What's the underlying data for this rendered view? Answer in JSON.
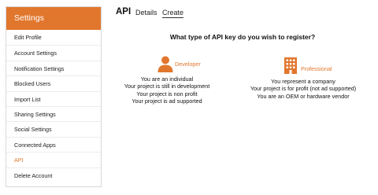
{
  "sidebar": {
    "header": "Settings",
    "items": [
      {
        "label": "Edit Profile"
      },
      {
        "label": "Account Settings"
      },
      {
        "label": "Notification Settings"
      },
      {
        "label": "Blocked Users"
      },
      {
        "label": "Import List"
      },
      {
        "label": "Sharing Settings"
      },
      {
        "label": "Social Settings"
      },
      {
        "label": "Connected Apps"
      },
      {
        "label": "API"
      },
      {
        "label": "Delete Account"
      }
    ],
    "active_item": "API"
  },
  "header": {
    "title": "API",
    "tabs": [
      {
        "label": "Details"
      },
      {
        "label": "Create"
      }
    ],
    "active_tab": "Create"
  },
  "main": {
    "question": "What type of API key do you wish to register?",
    "options": {
      "developer": {
        "icon": "person-icon",
        "title": "Developer",
        "lines": [
          "You are an individual",
          "Your project is still in development",
          "Your project is non profit",
          "Your project is ad supported"
        ]
      },
      "professional": {
        "icon": "building-icon",
        "title": "Professional",
        "lines": [
          "You represent a company",
          "Your project is for profit (not ad supported)",
          "You are an OEM or hardware vendor"
        ]
      }
    }
  },
  "colors": {
    "accent": "#e1772d",
    "text": "#222222",
    "border": "#d9d9d9"
  }
}
